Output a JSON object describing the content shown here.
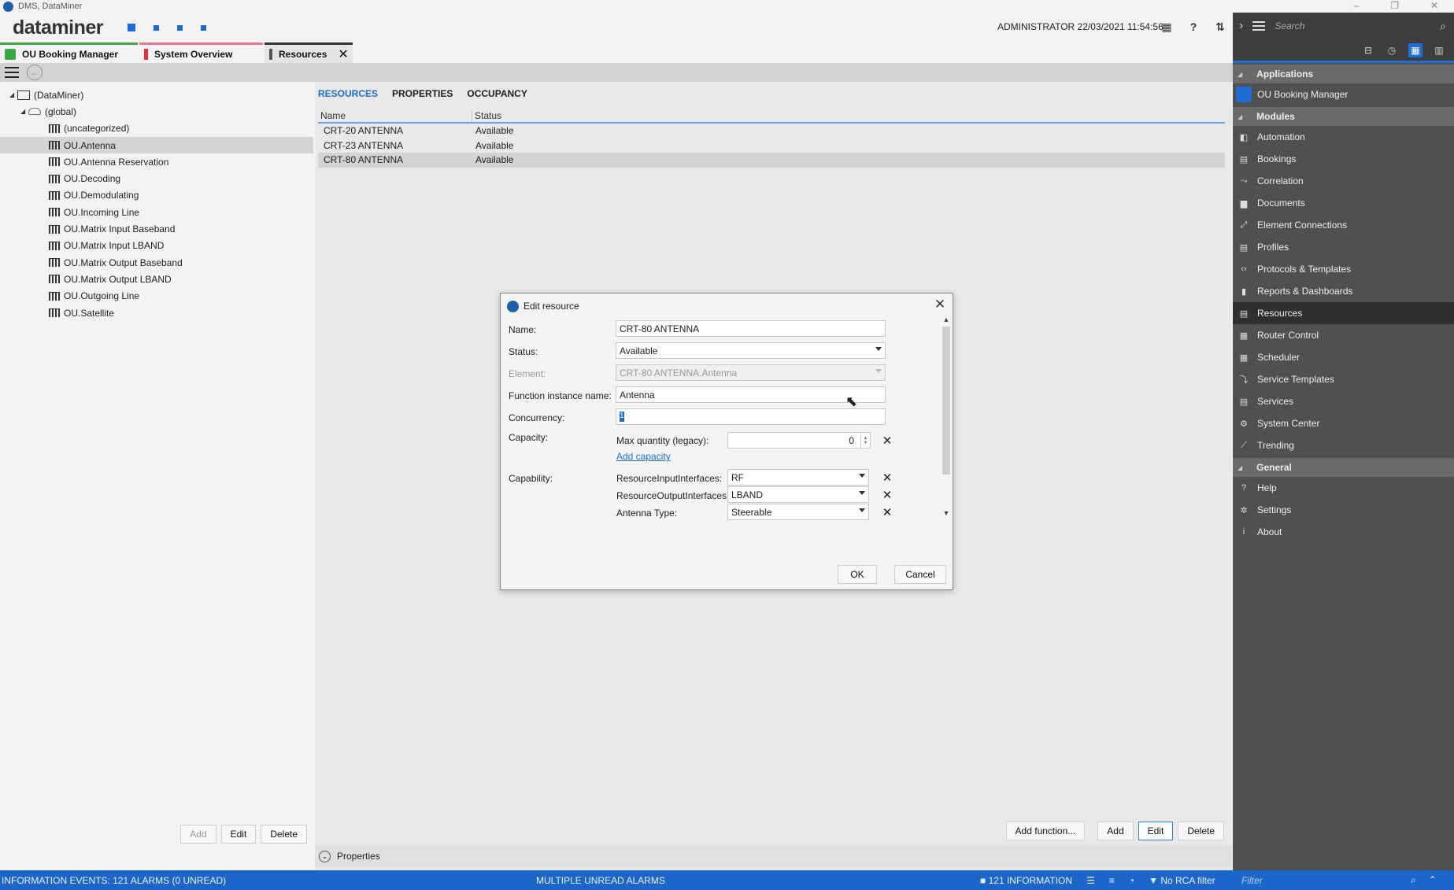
{
  "window": {
    "title": "DMS, DataMiner",
    "controls": [
      "–",
      "❐",
      "✕"
    ]
  },
  "header": {
    "brand": "dataminer",
    "user": "ADMINISTRATOR 22/03/2021 11:54:56"
  },
  "tabs": [
    {
      "label": "OU Booking Manager",
      "accent": "#3aa845"
    },
    {
      "label": "System Overview",
      "accent": "#e0303e"
    },
    {
      "label": "Resources",
      "accent": "#333333"
    }
  ],
  "tree": {
    "root": "(DataMiner)",
    "global": "(global)",
    "items": [
      "(uncategorized)",
      "OU.Antenna",
      "OU.Antenna Reservation",
      "OU.Decoding",
      "OU.Demodulating",
      "OU.Incoming Line",
      "OU.Matrix Input Baseband",
      "OU.Matrix Input LBAND",
      "OU.Matrix Output Baseband",
      "OU.Matrix Output LBAND",
      "OU.Outgoing Line",
      "OU.Satellite"
    ],
    "selected": "OU.Antenna",
    "buttons": {
      "add": "Add",
      "edit": "Edit",
      "delete": "Delete"
    }
  },
  "main": {
    "tabs": [
      "RESOURCES",
      "PROPERTIES",
      "OCCUPANCY"
    ],
    "columns": {
      "name": "Name",
      "status": "Status"
    },
    "rows": [
      {
        "name": "CRT-20 ANTENNA",
        "status": "Available"
      },
      {
        "name": "CRT-23 ANTENNA",
        "status": "Available"
      },
      {
        "name": "CRT-80 ANTENNA",
        "status": "Available"
      }
    ],
    "buttons": {
      "add_function": "Add function...",
      "add": "Add",
      "edit": "Edit",
      "delete": "Delete"
    },
    "properties_label": "Properties"
  },
  "dialog": {
    "title": "Edit resource",
    "labels": {
      "name": "Name:",
      "status": "Status:",
      "element": "Element:",
      "function_instance": "Function instance name:",
      "concurrency": "Concurrency:",
      "capacity": "Capacity:",
      "capability": "Capability:"
    },
    "values": {
      "name": "CRT-80 ANTENNA",
      "status": "Available",
      "element": "CRT-80 ANTENNA.Antenna",
      "function_instance": "Antenna",
      "concurrency": "1"
    },
    "capacity": {
      "label": "Max quantity (legacy):",
      "value": "0",
      "add_link": "Add capacity"
    },
    "capabilities": [
      {
        "label": "ResourceInputInterfaces:",
        "value": "RF"
      },
      {
        "label": "ResourceOutputInterfaces:",
        "value": "LBAND"
      },
      {
        "label": "Antenna Type:",
        "value": "Steerable"
      }
    ],
    "ok": "OK",
    "cancel": "Cancel"
  },
  "rpanel": {
    "search_placeholder": "Search",
    "applications_title": "Applications",
    "applications": [
      "OU Booking Manager"
    ],
    "modules_title": "Modules",
    "modules": [
      {
        "label": "Automation",
        "icon": "automation-icon"
      },
      {
        "label": "Bookings",
        "icon": "bookings-icon"
      },
      {
        "label": "Correlation",
        "icon": "correlation-icon"
      },
      {
        "label": "Documents",
        "icon": "folder-icon"
      },
      {
        "label": "Element Connections",
        "icon": "connections-icon"
      },
      {
        "label": "Profiles",
        "icon": "profiles-icon"
      },
      {
        "label": "Protocols & Templates",
        "icon": "code-icon"
      },
      {
        "label": "Reports & Dashboards",
        "icon": "chart-icon"
      },
      {
        "label": "Resources",
        "icon": "resources-icon"
      },
      {
        "label": "Router Control",
        "icon": "router-icon"
      },
      {
        "label": "Scheduler",
        "icon": "scheduler-icon"
      },
      {
        "label": "Service Templates",
        "icon": "service-templates-icon"
      },
      {
        "label": "Services",
        "icon": "services-icon"
      },
      {
        "label": "System Center",
        "icon": "system-center-icon"
      },
      {
        "label": "Trending",
        "icon": "trending-icon"
      }
    ],
    "selected_module": "Resources",
    "general_title": "General",
    "general": [
      {
        "label": "Help",
        "icon": "help-icon"
      },
      {
        "label": "Settings",
        "icon": "gear-icon"
      },
      {
        "label": "About",
        "icon": "info-icon"
      }
    ]
  },
  "statusbar": {
    "left": "INFORMATION EVENTS: 121 ALARMS (0 UNREAD)",
    "mid": "MULTIPLE UNREAD ALARMS",
    "info": "121 INFORMATION",
    "rca": "No RCA filter",
    "filter_placeholder": "Filter"
  }
}
